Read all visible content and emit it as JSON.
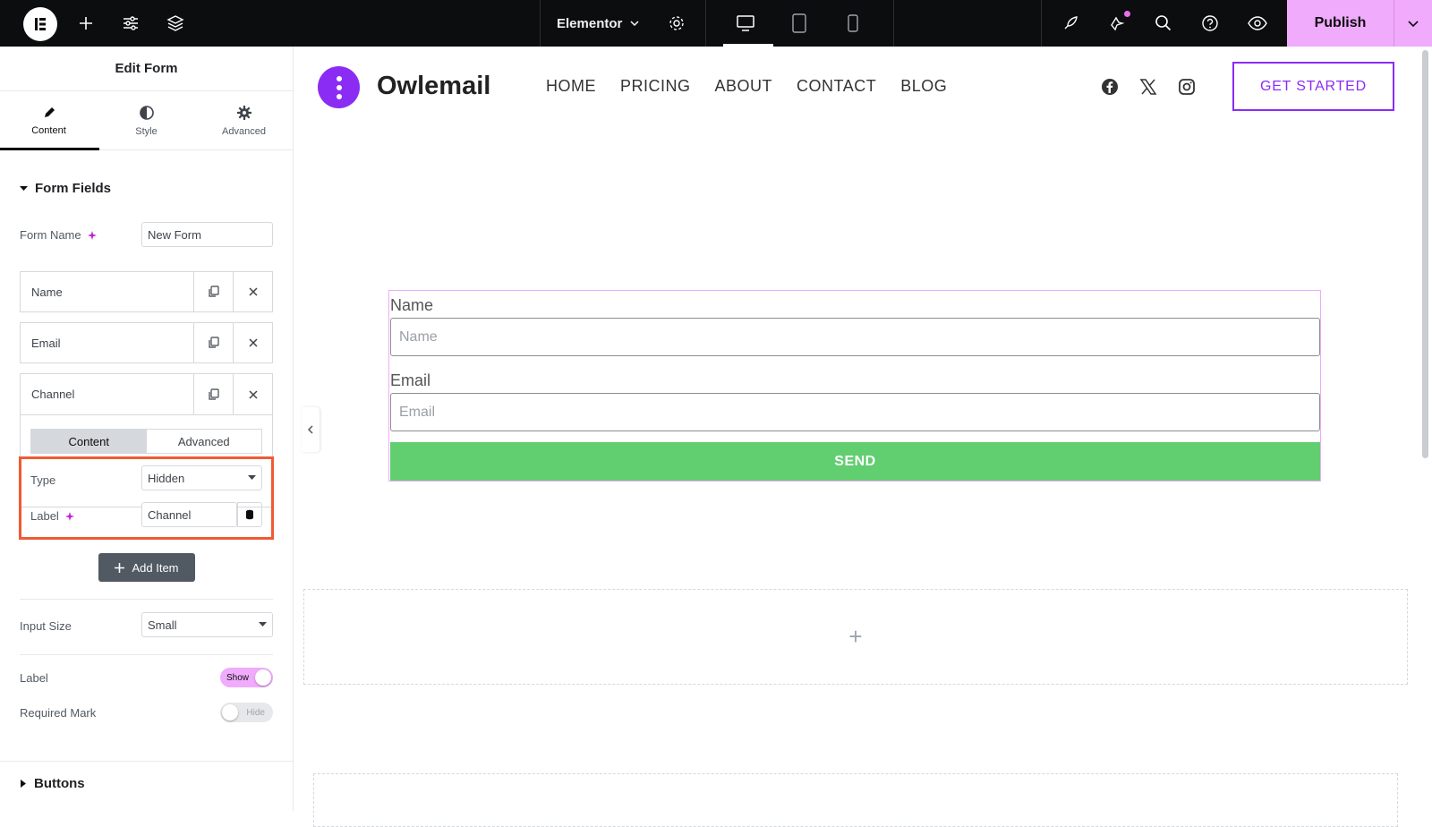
{
  "topbar": {
    "site_name": "Elementor",
    "publish_label": "Publish",
    "icons": [
      "elementor-logo-icon",
      "plus-icon",
      "sliders-icon",
      "layers-icon",
      "chevron-down-icon",
      "gear-icon",
      "desktop-icon",
      "tablet-icon",
      "mobile-icon",
      "rocket-icon",
      "notifications-icon",
      "search-icon",
      "help-icon",
      "eye-icon"
    ],
    "accent_color": "#f0abfc"
  },
  "panel": {
    "title": "Edit Form",
    "tabs": [
      {
        "label": "Content"
      },
      {
        "label": "Style"
      },
      {
        "label": "Advanced"
      }
    ],
    "form_fields_title": "Form Fields",
    "form_name_label": "Form Name",
    "form_name_value": "New Form",
    "fields": [
      {
        "label": "Name"
      },
      {
        "label": "Email"
      },
      {
        "label": "Channel"
      }
    ],
    "inner_tabs": [
      {
        "label": "Content"
      },
      {
        "label": "Advanced"
      }
    ],
    "type_label": "Type",
    "type_value": "Hidden",
    "label_label": "Label",
    "label_value": "Channel",
    "add_item_label": "Add Item",
    "input_size_label": "Input Size",
    "input_size_value": "Small",
    "label_toggle_label": "Label",
    "label_toggle_state": "Show",
    "required_mark_label": "Required Mark",
    "required_mark_state": "Hide",
    "buttons_section_title": "Buttons",
    "highlight_color": "#f05a34"
  },
  "site": {
    "brand": "Owlemail",
    "nav": [
      {
        "label": "HOME"
      },
      {
        "label": "PRICING"
      },
      {
        "label": "ABOUT"
      },
      {
        "label": "CONTACT"
      },
      {
        "label": "BLOG"
      }
    ],
    "social_icons": [
      "facebook-icon",
      "x-icon",
      "instagram-icon"
    ],
    "cta_label": "GET STARTED",
    "brand_color": "#8b2cf5"
  },
  "form": {
    "name_label": "Name",
    "name_placeholder": "Name",
    "email_label": "Email",
    "email_placeholder": "Email",
    "send_label": "SEND",
    "send_color": "#61ce70"
  },
  "canvas": {
    "add_section_symbol": "+"
  }
}
